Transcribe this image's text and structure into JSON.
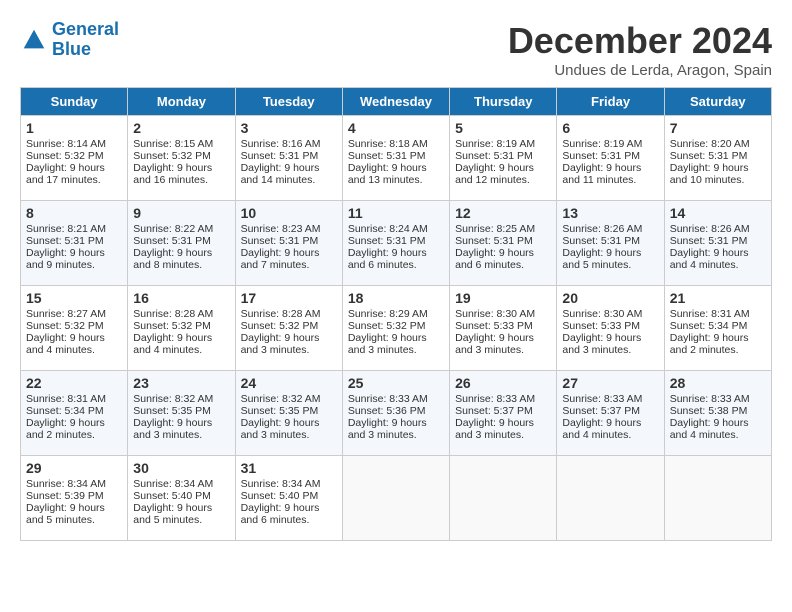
{
  "header": {
    "logo_line1": "General",
    "logo_line2": "Blue",
    "title": "December 2024",
    "location": "Undues de Lerda, Aragon, Spain"
  },
  "days_of_week": [
    "Sunday",
    "Monday",
    "Tuesday",
    "Wednesday",
    "Thursday",
    "Friday",
    "Saturday"
  ],
  "weeks": [
    [
      {
        "day": 1,
        "sunrise": "8:14 AM",
        "sunset": "5:32 PM",
        "daylight": "9 hours and 17 minutes."
      },
      {
        "day": 2,
        "sunrise": "8:15 AM",
        "sunset": "5:32 PM",
        "daylight": "9 hours and 16 minutes."
      },
      {
        "day": 3,
        "sunrise": "8:16 AM",
        "sunset": "5:31 PM",
        "daylight": "9 hours and 14 minutes."
      },
      {
        "day": 4,
        "sunrise": "8:18 AM",
        "sunset": "5:31 PM",
        "daylight": "9 hours and 13 minutes."
      },
      {
        "day": 5,
        "sunrise": "8:19 AM",
        "sunset": "5:31 PM",
        "daylight": "9 hours and 12 minutes."
      },
      {
        "day": 6,
        "sunrise": "8:19 AM",
        "sunset": "5:31 PM",
        "daylight": "9 hours and 11 minutes."
      },
      {
        "day": 7,
        "sunrise": "8:20 AM",
        "sunset": "5:31 PM",
        "daylight": "9 hours and 10 minutes."
      }
    ],
    [
      {
        "day": 8,
        "sunrise": "8:21 AM",
        "sunset": "5:31 PM",
        "daylight": "9 hours and 9 minutes."
      },
      {
        "day": 9,
        "sunrise": "8:22 AM",
        "sunset": "5:31 PM",
        "daylight": "9 hours and 8 minutes."
      },
      {
        "day": 10,
        "sunrise": "8:23 AM",
        "sunset": "5:31 PM",
        "daylight": "9 hours and 7 minutes."
      },
      {
        "day": 11,
        "sunrise": "8:24 AM",
        "sunset": "5:31 PM",
        "daylight": "9 hours and 6 minutes."
      },
      {
        "day": 12,
        "sunrise": "8:25 AM",
        "sunset": "5:31 PM",
        "daylight": "9 hours and 6 minutes."
      },
      {
        "day": 13,
        "sunrise": "8:26 AM",
        "sunset": "5:31 PM",
        "daylight": "9 hours and 5 minutes."
      },
      {
        "day": 14,
        "sunrise": "8:26 AM",
        "sunset": "5:31 PM",
        "daylight": "9 hours and 4 minutes."
      }
    ],
    [
      {
        "day": 15,
        "sunrise": "8:27 AM",
        "sunset": "5:32 PM",
        "daylight": "9 hours and 4 minutes."
      },
      {
        "day": 16,
        "sunrise": "8:28 AM",
        "sunset": "5:32 PM",
        "daylight": "9 hours and 4 minutes."
      },
      {
        "day": 17,
        "sunrise": "8:28 AM",
        "sunset": "5:32 PM",
        "daylight": "9 hours and 3 minutes."
      },
      {
        "day": 18,
        "sunrise": "8:29 AM",
        "sunset": "5:32 PM",
        "daylight": "9 hours and 3 minutes."
      },
      {
        "day": 19,
        "sunrise": "8:30 AM",
        "sunset": "5:33 PM",
        "daylight": "9 hours and 3 minutes."
      },
      {
        "day": 20,
        "sunrise": "8:30 AM",
        "sunset": "5:33 PM",
        "daylight": "9 hours and 3 minutes."
      },
      {
        "day": 21,
        "sunrise": "8:31 AM",
        "sunset": "5:34 PM",
        "daylight": "9 hours and 2 minutes."
      }
    ],
    [
      {
        "day": 22,
        "sunrise": "8:31 AM",
        "sunset": "5:34 PM",
        "daylight": "9 hours and 2 minutes."
      },
      {
        "day": 23,
        "sunrise": "8:32 AM",
        "sunset": "5:35 PM",
        "daylight": "9 hours and 3 minutes."
      },
      {
        "day": 24,
        "sunrise": "8:32 AM",
        "sunset": "5:35 PM",
        "daylight": "9 hours and 3 minutes."
      },
      {
        "day": 25,
        "sunrise": "8:33 AM",
        "sunset": "5:36 PM",
        "daylight": "9 hours and 3 minutes."
      },
      {
        "day": 26,
        "sunrise": "8:33 AM",
        "sunset": "5:37 PM",
        "daylight": "9 hours and 3 minutes."
      },
      {
        "day": 27,
        "sunrise": "8:33 AM",
        "sunset": "5:37 PM",
        "daylight": "9 hours and 4 minutes."
      },
      {
        "day": 28,
        "sunrise": "8:33 AM",
        "sunset": "5:38 PM",
        "daylight": "9 hours and 4 minutes."
      }
    ],
    [
      {
        "day": 29,
        "sunrise": "8:34 AM",
        "sunset": "5:39 PM",
        "daylight": "9 hours and 5 minutes."
      },
      {
        "day": 30,
        "sunrise": "8:34 AM",
        "sunset": "5:40 PM",
        "daylight": "9 hours and 5 minutes."
      },
      {
        "day": 31,
        "sunrise": "8:34 AM",
        "sunset": "5:40 PM",
        "daylight": "9 hours and 6 minutes."
      },
      null,
      null,
      null,
      null
    ]
  ]
}
